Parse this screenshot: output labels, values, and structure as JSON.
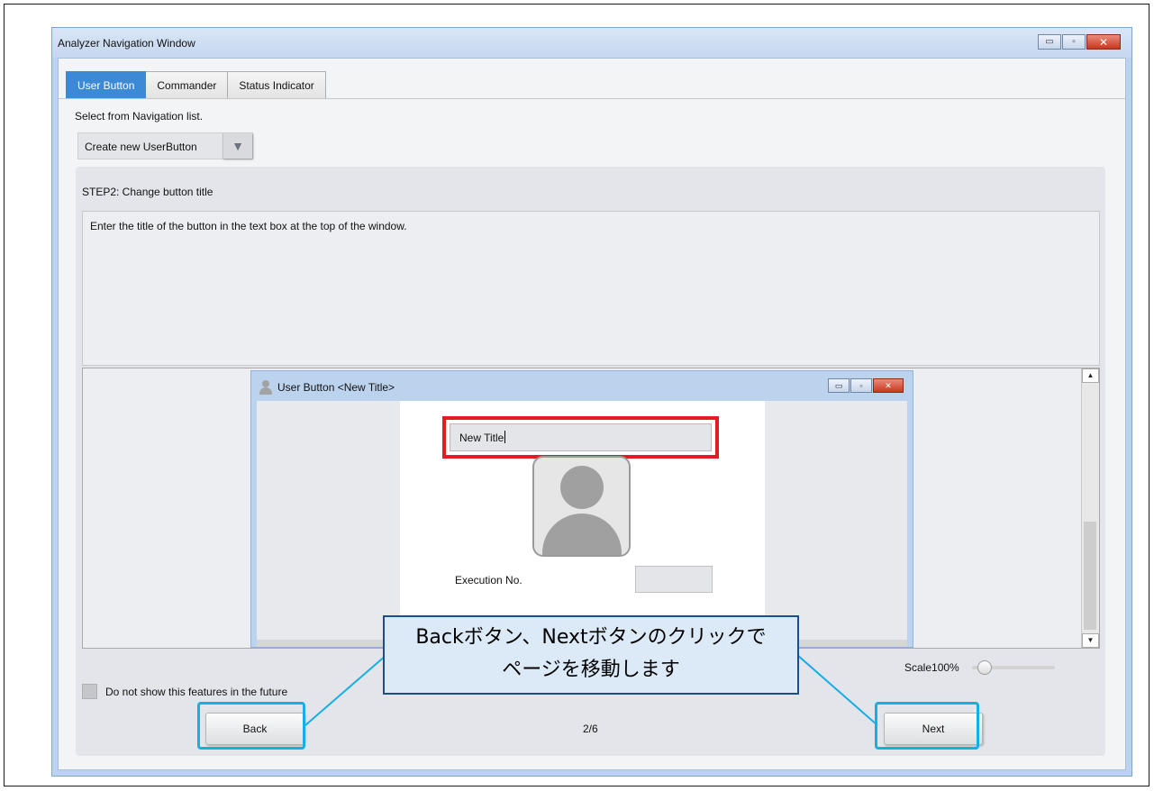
{
  "window": {
    "title": "Analyzer Navigation Window",
    "caption_buttons": {
      "minimize": "▭",
      "maximize": "▫",
      "close": "✕"
    }
  },
  "tabs": [
    {
      "label": "User Button",
      "active": true
    },
    {
      "label": "Commander",
      "active": false
    },
    {
      "label": "Status Indicator",
      "active": false
    }
  ],
  "navigation": {
    "select_label": "Select from Navigation list.",
    "dropdown_value": "Create new UserButton",
    "dropdown_icon": "triangle-down-icon"
  },
  "step": {
    "title": "STEP2: Change button title",
    "description": "Enter the title of the button in the text box at the top of the window."
  },
  "preview_window": {
    "title": "User Button <New Title>",
    "title_input_value": "New Title",
    "execution_label": "Execution No.",
    "execution_value": ""
  },
  "scale": {
    "label": "Scale100%",
    "value_percent": 100
  },
  "checkbox": {
    "label": "Do not show this features in the future",
    "checked": false
  },
  "footer": {
    "back_label": "Back",
    "next_label": "Next",
    "page_indicator": "2/6"
  },
  "annotation": {
    "callout_line1": "Backボタン、Nextボタンのクリックで",
    "callout_line2": "ページを移動します"
  },
  "colors": {
    "active_tab": "#3c8ad6",
    "highlight_red": "#e31b22",
    "highlight_cyan": "#17aee5",
    "callout_border": "#1a4e8c",
    "callout_fill": "#dce9f7"
  }
}
